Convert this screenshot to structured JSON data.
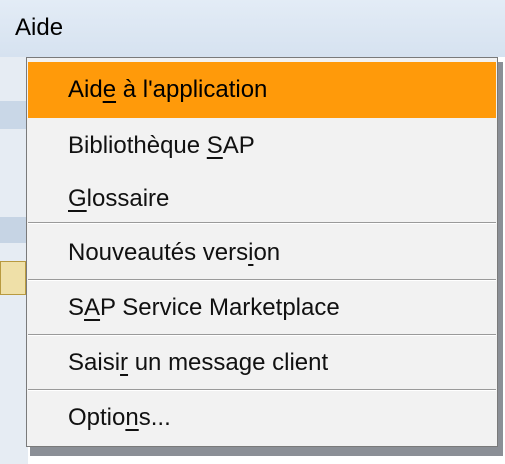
{
  "menubar": {
    "title": "Aide"
  },
  "menu": {
    "items": [
      {
        "pre": "Aid",
        "mnemonic": "e",
        "post": " à l'application",
        "active": true
      },
      {
        "pre": "Bibliothèque ",
        "mnemonic": "S",
        "post": "AP"
      },
      {
        "pre": "",
        "mnemonic": "G",
        "post": "lossaire"
      },
      {
        "pre": "Nouveautés vers",
        "mnemonic": "i",
        "post": "on"
      },
      {
        "pre": "S",
        "mnemonic": "A",
        "post": "P Service Marketplace"
      },
      {
        "pre": "Saisi",
        "mnemonic": "r",
        "post": " un message client"
      },
      {
        "pre": "Optio",
        "mnemonic": "n",
        "post": "s..."
      }
    ]
  },
  "colors": {
    "highlight": "#ff9a0a",
    "menu_background": "#f2f2f2",
    "menubar_background": "#dbe6f2"
  }
}
